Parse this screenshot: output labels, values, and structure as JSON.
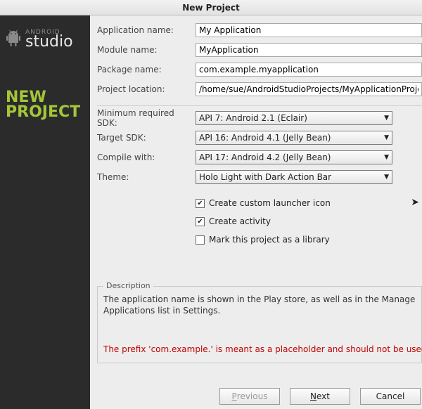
{
  "title": "New Project",
  "sidebar": {
    "logo_small": "ANDROID",
    "logo_big": "studio",
    "heading_l1": "NEW",
    "heading_l2": "PROJECT"
  },
  "form": {
    "app_name_label": "Application name:",
    "app_name_value": "My Application",
    "module_name_label": "Module name:",
    "module_name_value": "MyApplication",
    "package_name_label": "Package name:",
    "package_name_value": "com.example.myapplication",
    "project_location_label": "Project location:",
    "project_location_value": "/home/sue/AndroidStudioProjects/MyApplicationProject",
    "min_sdk_label": "Minimum required SDK:",
    "min_sdk_value": "API 7: Android 2.1 (Eclair)",
    "target_sdk_label": "Target SDK:",
    "target_sdk_value": "API 16: Android 4.1 (Jelly Bean)",
    "compile_with_label": "Compile with:",
    "compile_with_value": "API 17: Android 4.2 (Jelly Bean)",
    "theme_label": "Theme:",
    "theme_value": "Holo Light with Dark Action Bar",
    "chk_launcher": "Create custom launcher icon",
    "chk_activity": "Create activity",
    "chk_library": "Mark this project as a library"
  },
  "description": {
    "legend": "Description",
    "text": "The application name is shown in the Play store, as well as in the Manage Applications list in Settings."
  },
  "warning": "The prefix 'com.example.' is meant as a placeholder and should not be used",
  "buttons": {
    "previous_p": "P",
    "previous_rest": "revious",
    "next_n": "N",
    "next_rest": "ext",
    "cancel": "Cancel"
  }
}
